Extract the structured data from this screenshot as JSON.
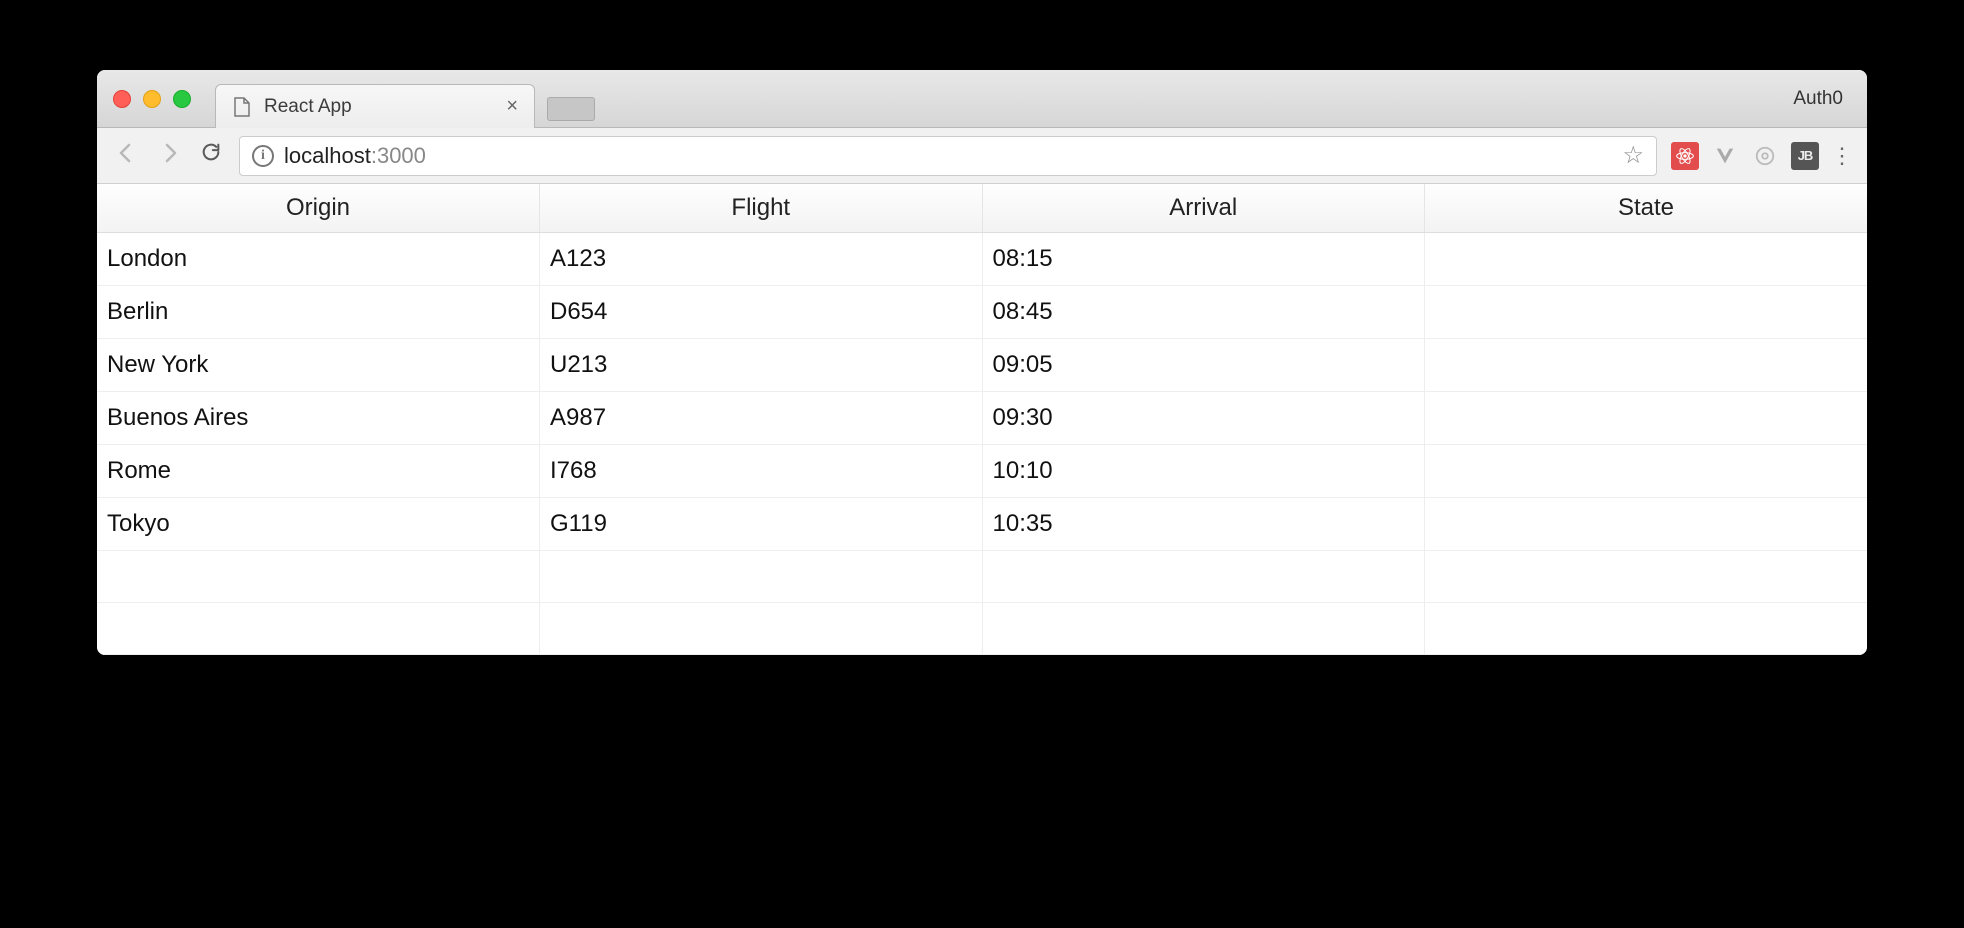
{
  "browser": {
    "tab_title": "React App",
    "profile_label": "Auth0",
    "url_host": "localhost",
    "url_port": ":3000"
  },
  "table": {
    "headers": {
      "origin": "Origin",
      "flight": "Flight",
      "arrival": "Arrival",
      "state": "State"
    },
    "rows": [
      {
        "origin": "London",
        "flight": "A123",
        "arrival": "08:15",
        "state": ""
      },
      {
        "origin": "Berlin",
        "flight": "D654",
        "arrival": "08:45",
        "state": ""
      },
      {
        "origin": "New York",
        "flight": "U213",
        "arrival": "09:05",
        "state": ""
      },
      {
        "origin": "Buenos Aires",
        "flight": "A987",
        "arrival": "09:30",
        "state": ""
      },
      {
        "origin": "Rome",
        "flight": "I768",
        "arrival": "10:10",
        "state": ""
      },
      {
        "origin": "Tokyo",
        "flight": "G119",
        "arrival": "10:35",
        "state": ""
      }
    ],
    "empty_rows": 2
  }
}
